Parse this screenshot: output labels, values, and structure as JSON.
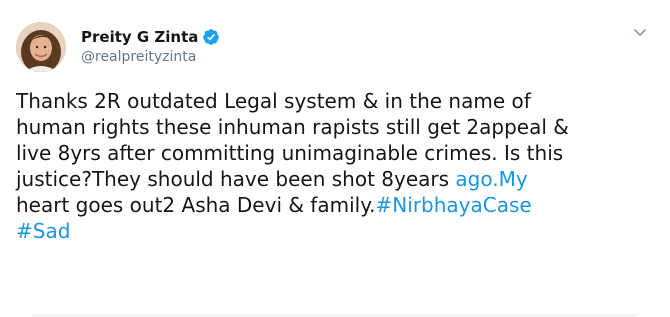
{
  "author": {
    "display_name": "Preity G Zinta",
    "handle": "@realpreityzinta",
    "verified": true,
    "avatar_icon": "profile-photo"
  },
  "menu": {
    "icon": "chevron-down-icon"
  },
  "tweet": {
    "line1": "Thanks 2R outdated Legal system & in the name of",
    "line2": "human rights these inhuman rapists still get 2appeal &",
    "line3": "live 8yrs after committing unimaginable crimes. Is this",
    "line4_text": "justice?They should have been shot 8years ",
    "line4_link": "ago.My",
    "line5_text": " heart goes out2 Asha Devi & family.",
    "line5_hashtag": "#NirbhayaCase",
    "line6_hashtag": "#Sad"
  },
  "colors": {
    "link": "#1b95e0",
    "verified": "#1da1f2",
    "text": "#14171a",
    "secondary": "#657786"
  }
}
